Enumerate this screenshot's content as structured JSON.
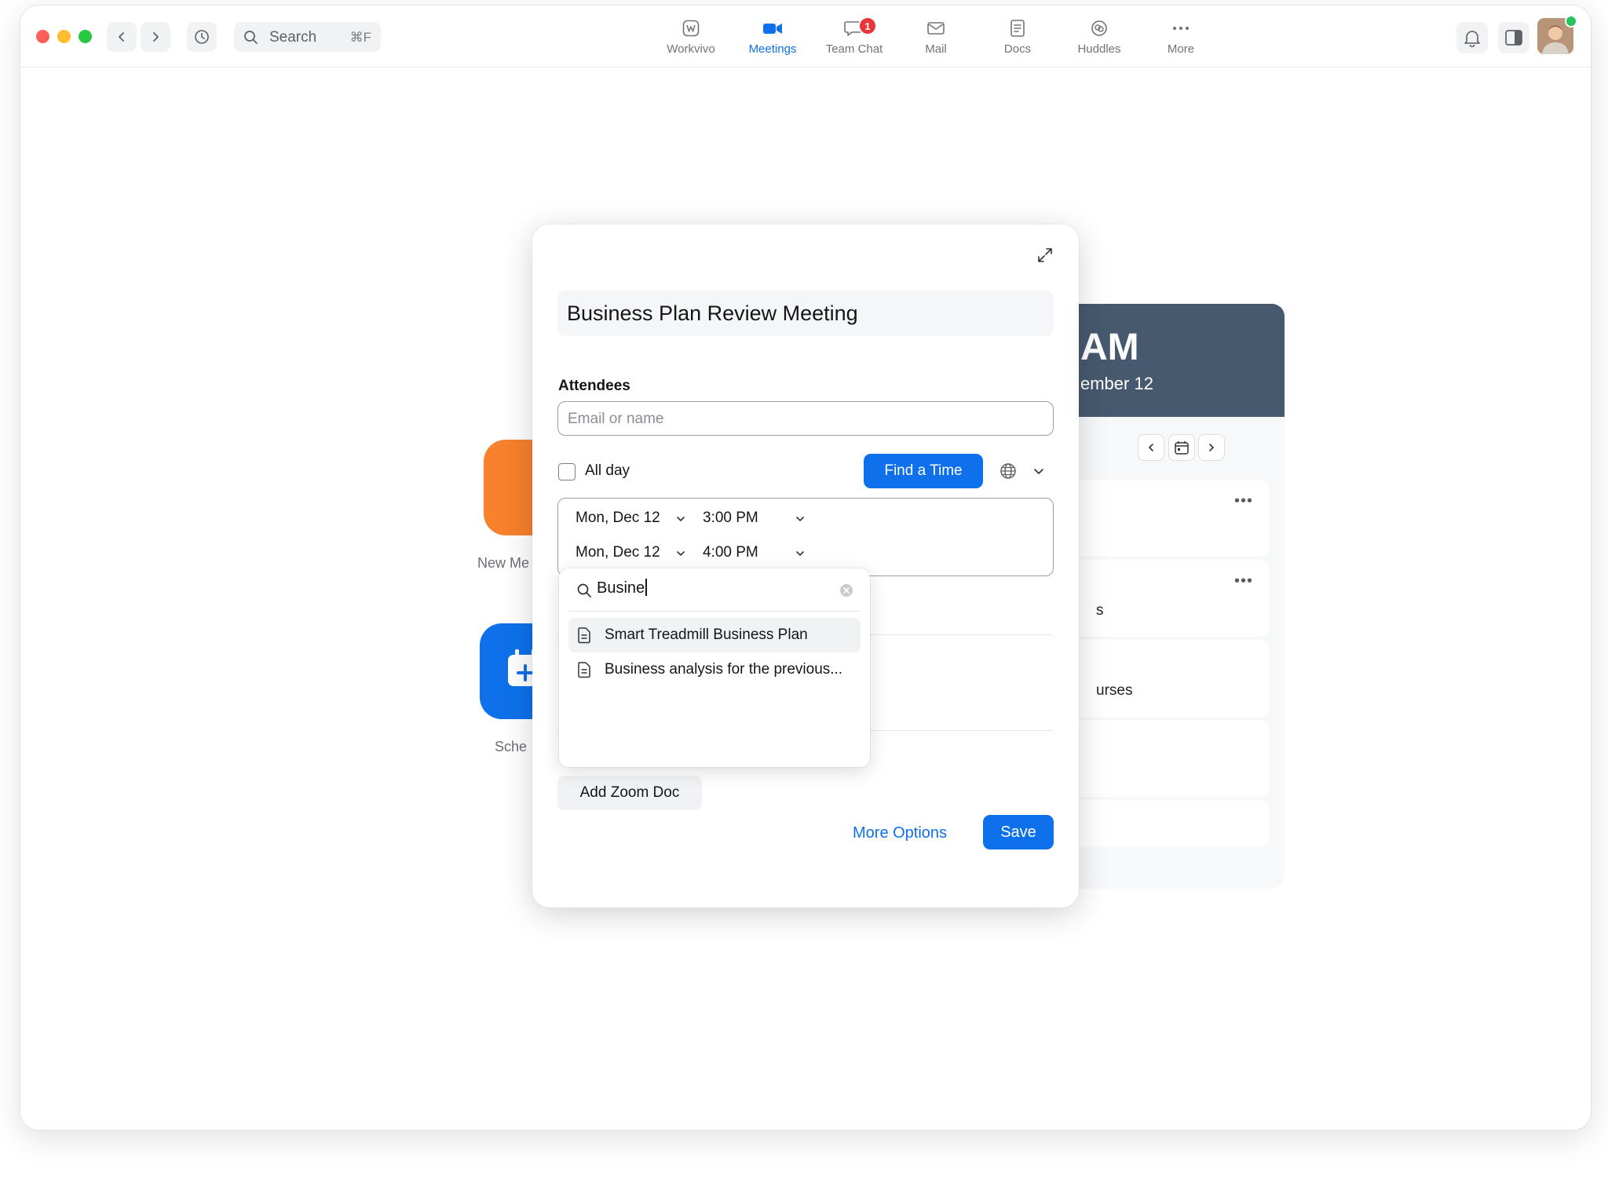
{
  "toolbar": {
    "search_placeholder": "Search",
    "search_shortcut": "⌘F"
  },
  "nav": [
    {
      "label": "Workvivo",
      "icon": "workvivo-icon",
      "active": false
    },
    {
      "label": "Meetings",
      "icon": "video-camera-icon",
      "active": true
    },
    {
      "label": "Team Chat",
      "icon": "chat-bubble-icon",
      "active": false,
      "badge": "1"
    },
    {
      "label": "Mail",
      "icon": "mail-icon",
      "active": false
    },
    {
      "label": "Docs",
      "icon": "document-icon",
      "active": false
    },
    {
      "label": "Huddles",
      "icon": "huddles-icon",
      "active": false
    },
    {
      "label": "More",
      "icon": "more-dots-icon",
      "active": false
    }
  ],
  "background": {
    "tile_new_label": "New Me",
    "tile_schedule_label": "Sche",
    "calendar_time": "AM",
    "calendar_date": "ember 12",
    "card_fragments": [
      "s",
      "urses"
    ]
  },
  "modal": {
    "title": "Business Plan Review Meeting",
    "attendees_label": "Attendees",
    "attendees_placeholder": "Email or name",
    "all_day_label": "All day",
    "all_day_checked": false,
    "find_time_label": "Find a Time",
    "start_date": "Mon, Dec 12",
    "start_time": "3:00 PM",
    "end_date": "Mon, Dec 12",
    "end_time": "4:00 PM",
    "add_doc_label": "Add Zoom Doc",
    "more_options_label": "More Options",
    "save_label": "Save"
  },
  "doc_search": {
    "query": "Busine",
    "results": [
      "Smart Treadmill Business Plan",
      "Business analysis for the previous..."
    ]
  },
  "colors": {
    "accent": "#0e71eb",
    "badge": "#e8363a",
    "calendar_header": "#47596f",
    "tile_orange": "#f7812d"
  }
}
